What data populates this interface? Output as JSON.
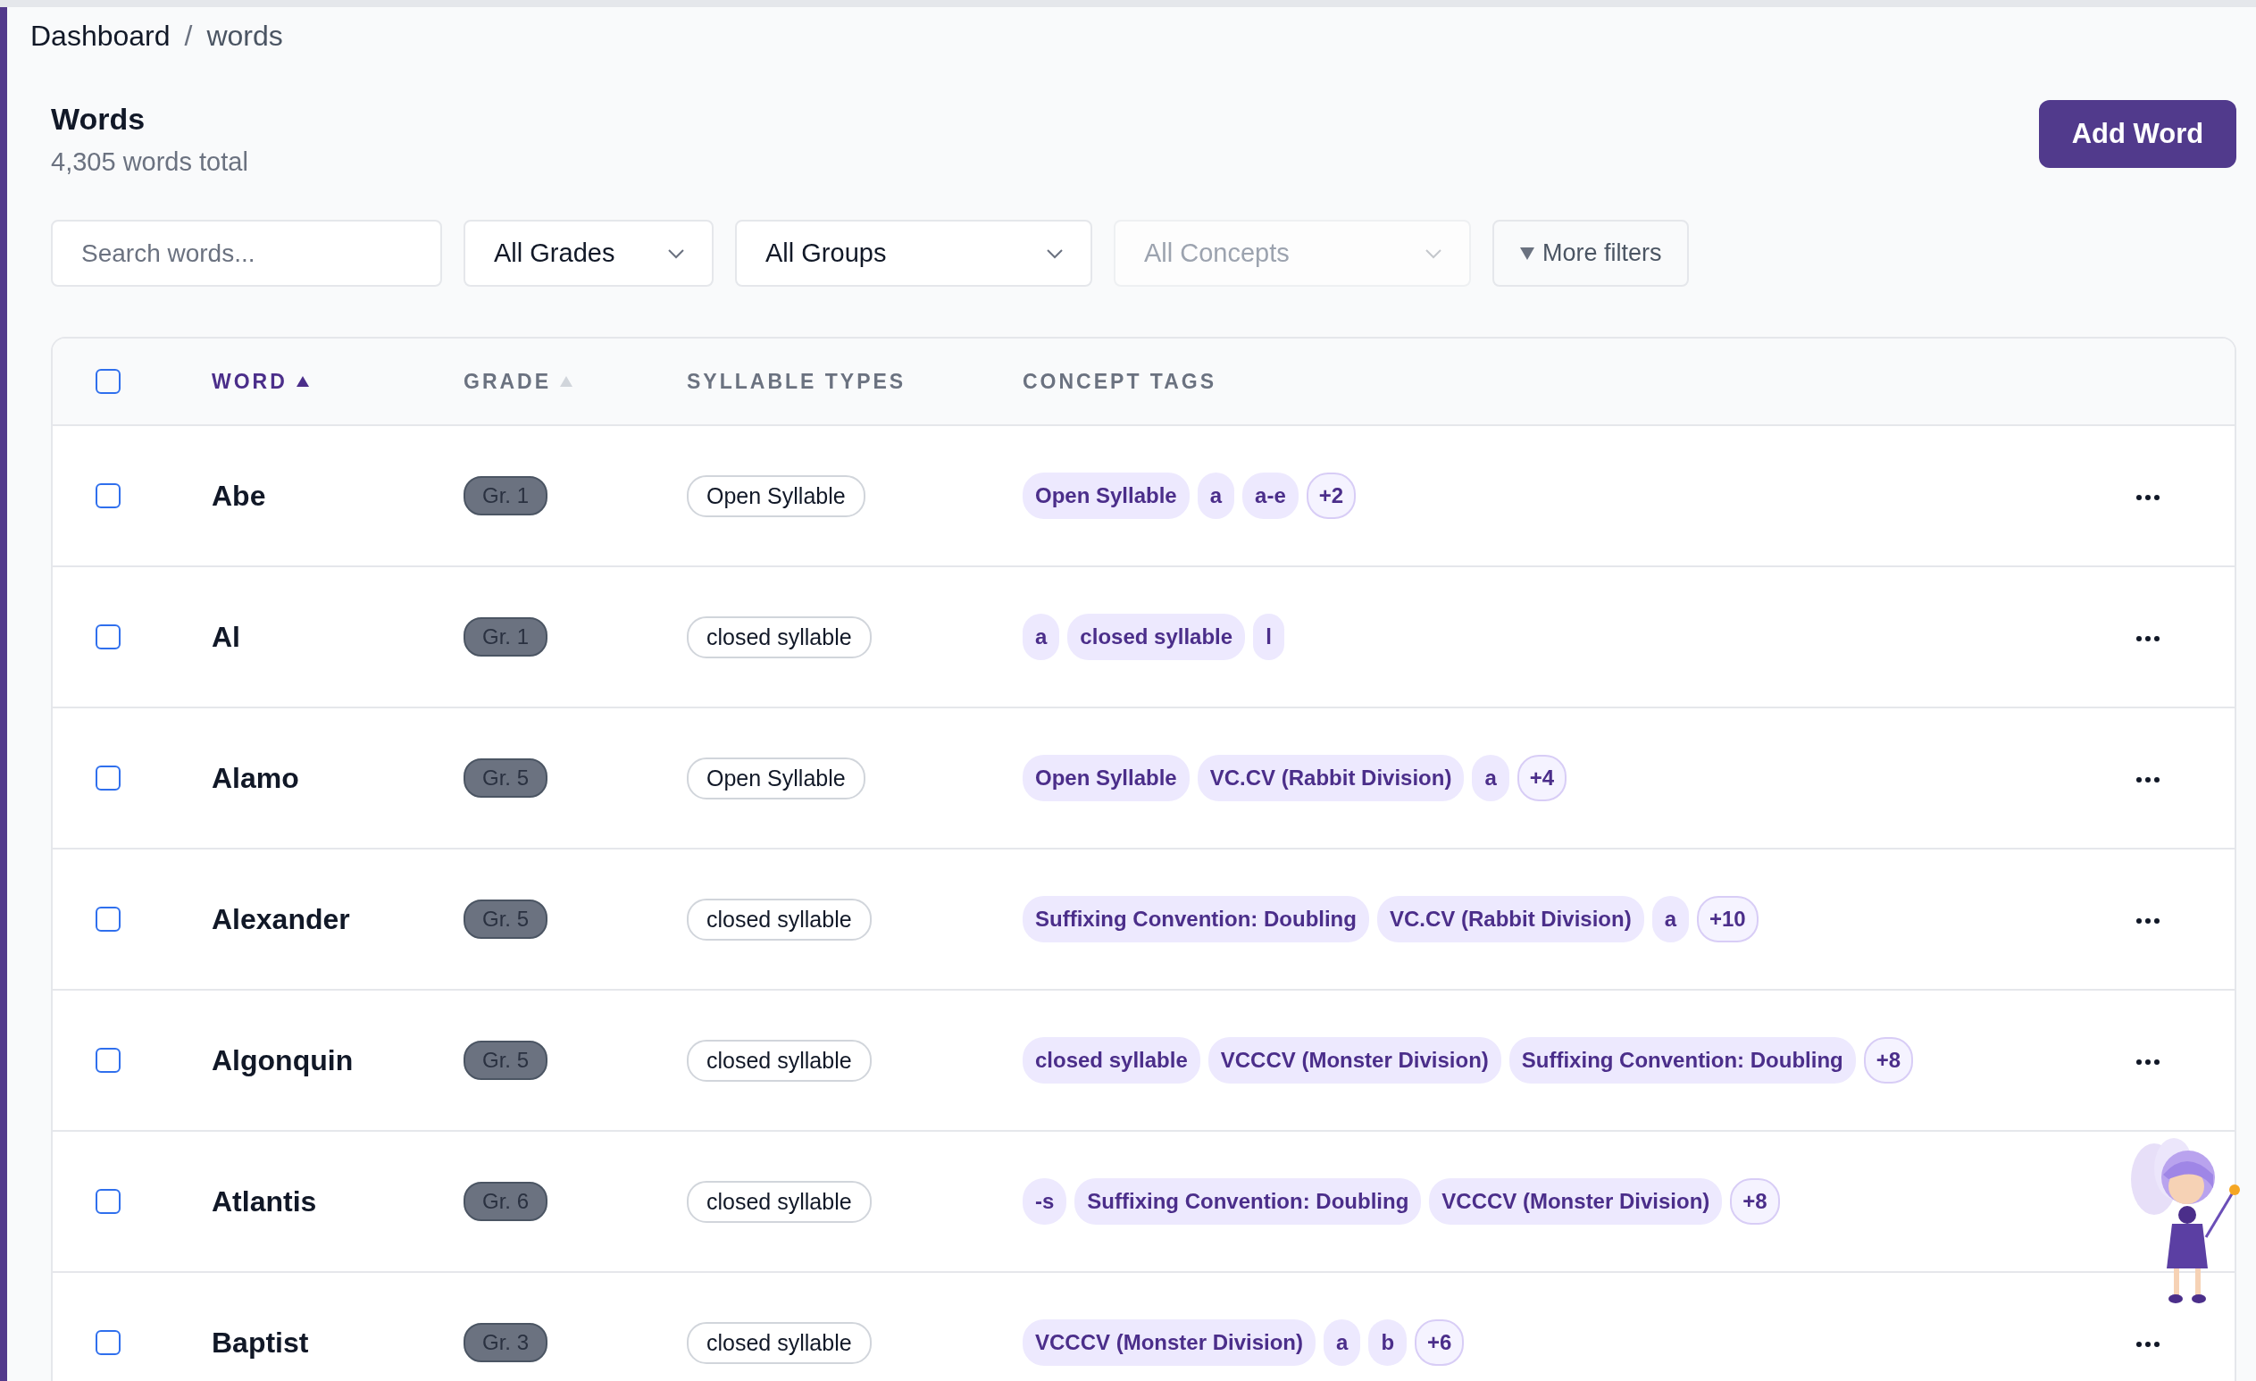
{
  "breadcrumb": [
    {
      "label": "Dashboard"
    },
    {
      "label": "words"
    }
  ],
  "breadcrumb_separator": "/",
  "header": {
    "title": "Words",
    "subtitle": "4,305 words total",
    "add_button": "Add Word"
  },
  "filters": {
    "search": {
      "placeholder": "Search words..."
    },
    "selects": [
      {
        "label": "All Grades",
        "disabled": false
      },
      {
        "label": "All Groups",
        "disabled": false
      },
      {
        "label": "All Concepts",
        "disabled": true
      }
    ],
    "more_filters": "More filters"
  },
  "table": {
    "select_all": {
      "checked": false
    },
    "columns": [
      {
        "label": "WORD",
        "kind": "sort",
        "selected": true
      },
      {
        "label": "GRADE",
        "kind": "sort",
        "selected": false
      },
      {
        "label": "SYLLABLE TYPES",
        "kind": "plain"
      },
      {
        "label": "CONCEPT TAGS",
        "kind": "plain"
      }
    ],
    "rows": [
      {
        "checked": false,
        "word": "Abe",
        "grade": "Gr. 1",
        "syllable": "Open Syllable",
        "tags": [
          {
            "label": "Open Syllable",
            "kind": "tag"
          },
          {
            "label": "a",
            "kind": "tag"
          },
          {
            "label": "a-e",
            "kind": "tag"
          },
          {
            "label": "+2",
            "kind": "more"
          }
        ],
        "menu": true
      },
      {
        "checked": false,
        "word": "Al",
        "grade": "Gr. 1",
        "syllable": "closed syllable",
        "tags": [
          {
            "label": "a",
            "kind": "tag"
          },
          {
            "label": "closed syllable",
            "kind": "tag"
          },
          {
            "label": "l",
            "kind": "tag"
          }
        ],
        "menu": true
      },
      {
        "checked": false,
        "word": "Alamo",
        "grade": "Gr. 5",
        "syllable": "Open Syllable",
        "tags": [
          {
            "label": "Open Syllable",
            "kind": "tag"
          },
          {
            "label": "VC.CV (Rabbit Division)",
            "kind": "tag"
          },
          {
            "label": "a",
            "kind": "tag"
          },
          {
            "label": "+4",
            "kind": "more"
          }
        ],
        "menu": true
      },
      {
        "checked": false,
        "word": "Alexander",
        "grade": "Gr. 5",
        "syllable": "closed syllable",
        "tags": [
          {
            "label": "Suffixing Convention: Doubling",
            "kind": "tag"
          },
          {
            "label": "VC.CV (Rabbit Division)",
            "kind": "tag"
          },
          {
            "label": "a",
            "kind": "tag"
          },
          {
            "label": "+10",
            "kind": "more"
          }
        ],
        "menu": true
      },
      {
        "checked": false,
        "word": "Algonquin",
        "grade": "Gr. 5",
        "syllable": "closed syllable",
        "tags": [
          {
            "label": "closed syllable",
            "kind": "tag"
          },
          {
            "label": "VCCCV (Monster Division)",
            "kind": "tag"
          },
          {
            "label": "Suffixing Convention: Doubling",
            "kind": "tag"
          },
          {
            "label": "+8",
            "kind": "more"
          }
        ],
        "menu": true
      },
      {
        "checked": false,
        "word": "Atlantis",
        "grade": "Gr. 6",
        "syllable": "closed syllable",
        "tags": [
          {
            "label": "-s",
            "kind": "tag"
          },
          {
            "label": "Suffixing Convention: Doubling",
            "kind": "tag"
          },
          {
            "label": "VCCCV (Monster Division)",
            "kind": "tag"
          },
          {
            "label": "+8",
            "kind": "more"
          }
        ],
        "menu": false
      },
      {
        "checked": false,
        "word": "Baptist",
        "grade": "Gr. 3",
        "syllable": "closed syllable",
        "tags": [
          {
            "label": "VCCCV (Monster Division)",
            "kind": "tag"
          },
          {
            "label": "a",
            "kind": "tag"
          },
          {
            "label": "b",
            "kind": "tag"
          },
          {
            "label": "+6",
            "kind": "more"
          }
        ],
        "menu": true
      }
    ]
  }
}
